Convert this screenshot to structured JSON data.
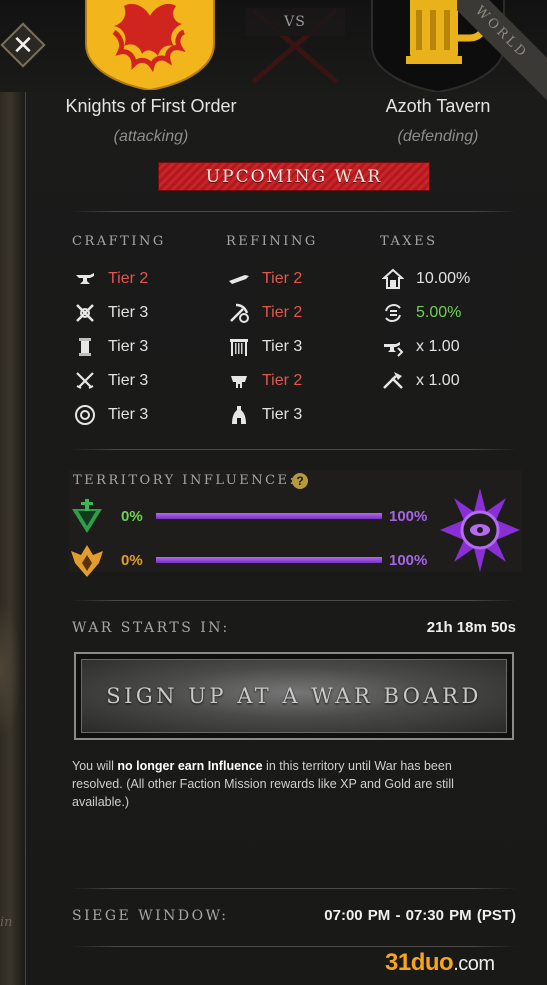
{
  "header": {
    "vs_label": "VS",
    "corner_text": "WORLD",
    "attacker": {
      "name": "Knights of First Order",
      "role": "(attacking)",
      "shield_color": "#f2b51c"
    },
    "defender": {
      "name": "Azoth Tavern",
      "role": "(defending)",
      "shield_color": "#0d0d0d"
    },
    "status": "UPCOMING WAR"
  },
  "stats": {
    "crafting": {
      "title": "CRAFTING",
      "items": [
        {
          "icon": "anvil-icon",
          "value": "Tier 2",
          "tone": "red"
        },
        {
          "icon": "crossed-tools-icon",
          "value": "Tier 3",
          "tone": "light"
        },
        {
          "icon": "scroll-icon",
          "value": "Tier 3",
          "tone": "light"
        },
        {
          "icon": "crossed-swords-icon",
          "value": "Tier 3",
          "tone": "light"
        },
        {
          "icon": "gem-ring-icon",
          "value": "Tier 3",
          "tone": "light"
        }
      ]
    },
    "refining": {
      "title": "REFINING",
      "items": [
        {
          "icon": "blade-icon",
          "value": "Tier 2",
          "tone": "red"
        },
        {
          "icon": "pickaxe-gear-icon",
          "value": "Tier 2",
          "tone": "red"
        },
        {
          "icon": "loom-icon",
          "value": "Tier 3",
          "tone": "light"
        },
        {
          "icon": "tannery-icon",
          "value": "Tier 2",
          "tone": "red"
        },
        {
          "icon": "kiln-icon",
          "value": "Tier 3",
          "tone": "light"
        }
      ]
    },
    "taxes": {
      "title": "TAXES",
      "items": [
        {
          "icon": "house-tax-icon",
          "value": "10.00%",
          "tone": "light"
        },
        {
          "icon": "trade-tax-icon",
          "value": "5.00%",
          "tone": "green"
        },
        {
          "icon": "crafting-fee-icon",
          "value": "x 1.00",
          "tone": "light"
        },
        {
          "icon": "refining-fee-icon",
          "value": "x 1.00",
          "tone": "light"
        }
      ]
    }
  },
  "territory": {
    "title": "TERRITORY INFLUENCE:",
    "help_icon": "?",
    "rows": [
      {
        "faction": "covenant",
        "emblem_color": "#3fb357",
        "left_pct": "0%",
        "left_tone": "green",
        "right_pct": "100%",
        "fill": 1.0
      },
      {
        "faction": "marauders",
        "emblem_color": "#e39d2e",
        "left_pct": "0%",
        "left_tone": "orange",
        "right_pct": "100%",
        "fill": 1.0
      }
    ],
    "controlling_emblem_color": "#9a3be0"
  },
  "war": {
    "starts_label": "WAR STARTS IN:",
    "countdown": "21h 18m 50s",
    "signup_button": "SIGN UP AT A WAR BOARD",
    "notice_pre": "You will ",
    "notice_bold": "no longer earn Influence",
    "notice_post": " in this territory until War has been resolved. (All other Faction Mission rewards like XP and Gold are still available.)",
    "siege_label": "SIEGE WINDOW:",
    "siege_time": "07:00 PM - 07:30 PM  (PST)"
  },
  "watermark": {
    "part1": "31duo",
    "part2": ".com"
  },
  "colors": {
    "red": "#e0574d",
    "green": "#6fd155",
    "purple": "#9a3be0",
    "gold": "#f2b51c"
  }
}
